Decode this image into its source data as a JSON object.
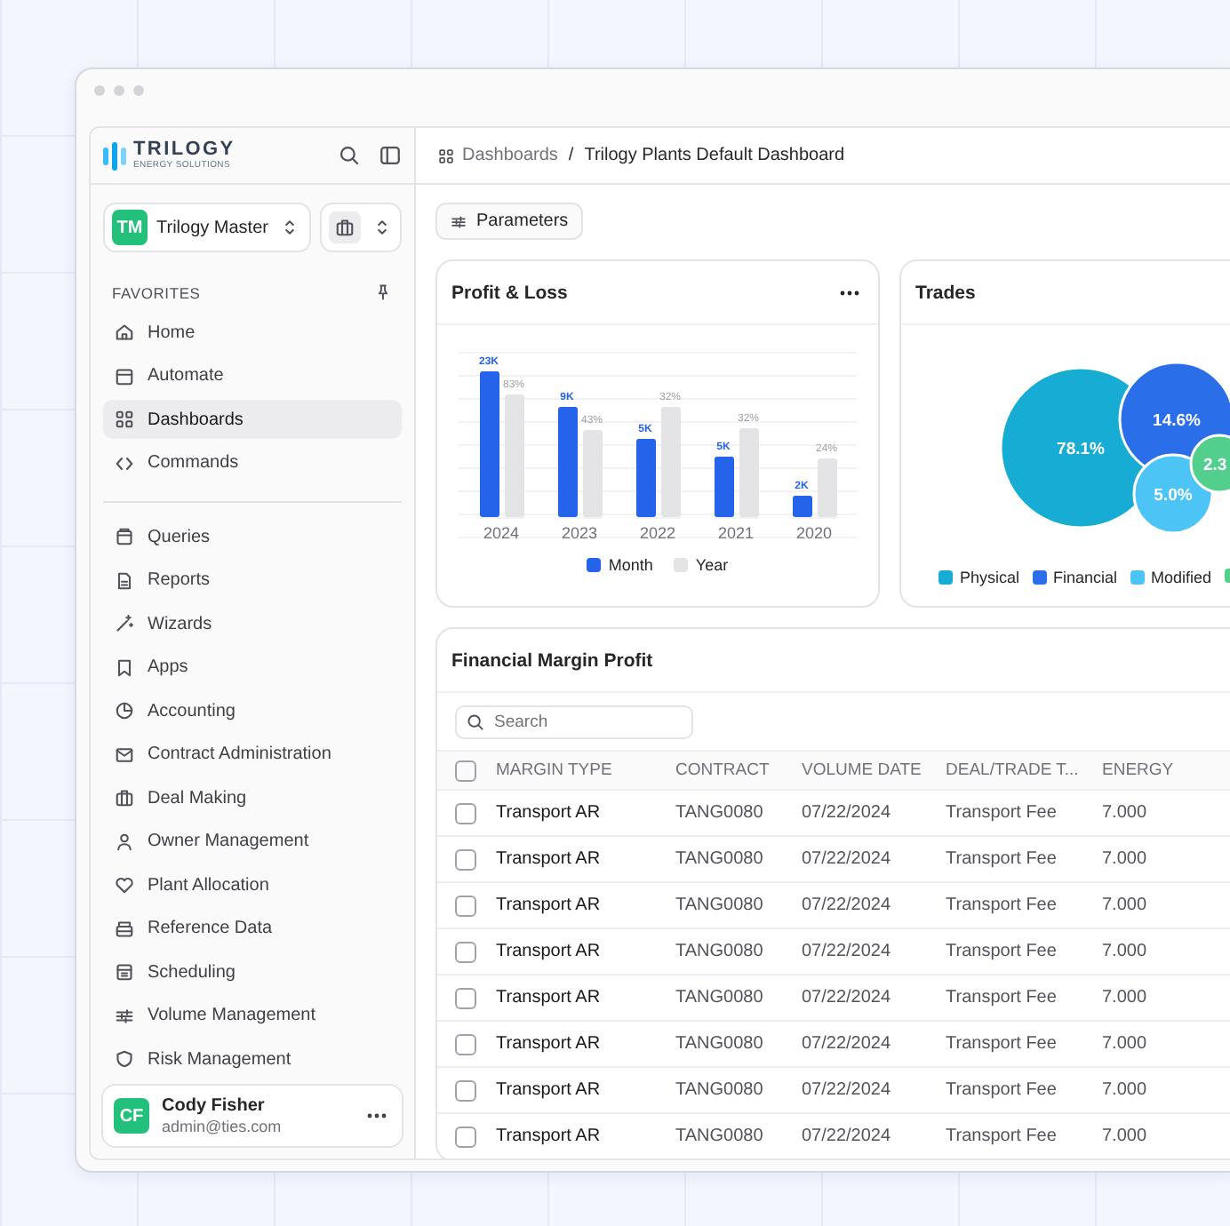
{
  "sidebar": {
    "logo": "TRILOGY",
    "logo_tagline": "ENERGY SOLUTIONS",
    "workspace": {
      "initials": "TM",
      "name": "Trilogy Master"
    },
    "favorites_label": "FAVORITES",
    "favorites": [
      {
        "label": "Home",
        "selected": false
      },
      {
        "label": "Automate",
        "selected": false
      },
      {
        "label": "Dashboards",
        "selected": true
      },
      {
        "label": "Commands",
        "selected": false
      }
    ],
    "items": [
      {
        "label": "Queries",
        "selected": false
      },
      {
        "label": "Reports",
        "selected": false
      },
      {
        "label": "Wizards",
        "selected": false
      },
      {
        "label": "Apps",
        "selected": false
      },
      {
        "label": "Accounting",
        "selected": false
      },
      {
        "label": "Contract Administration",
        "selected": false
      },
      {
        "label": "Deal Making",
        "selected": false
      },
      {
        "label": "Owner Management",
        "selected": false
      },
      {
        "label": "Plant Allocation",
        "selected": false
      },
      {
        "label": "Reference Data",
        "selected": false
      },
      {
        "label": "Scheduling",
        "selected": false
      },
      {
        "label": "Volume Management",
        "selected": false
      },
      {
        "label": "Risk Management",
        "selected": false
      }
    ],
    "user": {
      "initials": "CF",
      "name": "Cody Fisher",
      "email": "admin@ties.com"
    }
  },
  "breadcrumb": {
    "items": [
      "Dashboards",
      "Trilogy Plants Default Dashboard"
    ],
    "separator": "/"
  },
  "parameters_button": "Parameters",
  "profit_loss": {
    "title": "Profit & Loss",
    "legend": [
      {
        "name": "Month",
        "color": "#2563eb"
      },
      {
        "name": "Year",
        "color": "#e4e4e7"
      }
    ],
    "groups": [
      {
        "category": "2024",
        "bars": [
          {
            "label": "23K",
            "level": 0.88
          },
          {
            "label": "83%",
            "level": 0.74
          }
        ]
      },
      {
        "category": "2023",
        "bars": [
          {
            "label": "9K",
            "level": 0.67
          },
          {
            "label": "43%",
            "level": 0.53
          }
        ]
      },
      {
        "category": "2022",
        "bars": [
          {
            "label": "5K",
            "level": 0.47
          },
          {
            "label": "32%",
            "level": 0.67
          }
        ]
      },
      {
        "category": "2021",
        "bars": [
          {
            "label": "5K",
            "level": 0.37
          },
          {
            "label": "32%",
            "level": 0.54
          }
        ]
      },
      {
        "category": "2020",
        "bars": [
          {
            "label": "2K",
            "level": 0.13
          },
          {
            "label": "24%",
            "level": 0.35
          }
        ]
      }
    ]
  },
  "trades": {
    "title": "Trades",
    "bubbles": [
      {
        "name": "Physical",
        "color": "#17acd3",
        "label": "78.1%"
      },
      {
        "name": "Financial",
        "color": "#2b6eea",
        "label": "14.6%"
      },
      {
        "name": "Modified",
        "color": "#4cc4f5",
        "label": "5.0%"
      },
      {
        "color": "#52cf8c",
        "label": "2.3"
      }
    ]
  },
  "margin_table": {
    "title": "Financial Margin Profit",
    "search": {
      "placeholder": "Search"
    },
    "all_checked": false,
    "columns": [
      "MARGIN TYPE",
      "CONTRACT",
      "VOLUME DATE",
      "DEAL/TRADE T...",
      "ENERGY"
    ],
    "rows": [
      {
        "checked": false,
        "cells": [
          "Transport AR",
          "TANG0080",
          "07/22/2024",
          "Transport Fee",
          "7.000"
        ]
      },
      {
        "checked": false,
        "cells": [
          "Transport AR",
          "TANG0080",
          "07/22/2024",
          "Transport Fee",
          "7.000"
        ]
      },
      {
        "checked": false,
        "cells": [
          "Transport AR",
          "TANG0080",
          "07/22/2024",
          "Transport Fee",
          "7.000"
        ]
      },
      {
        "checked": false,
        "cells": [
          "Transport AR",
          "TANG0080",
          "07/22/2024",
          "Transport Fee",
          "7.000"
        ]
      },
      {
        "checked": false,
        "cells": [
          "Transport AR",
          "TANG0080",
          "07/22/2024",
          "Transport Fee",
          "7.000"
        ]
      },
      {
        "checked": false,
        "cells": [
          "Transport AR",
          "TANG0080",
          "07/22/2024",
          "Transport Fee",
          "7.000"
        ]
      },
      {
        "checked": false,
        "cells": [
          "Transport AR",
          "TANG0080",
          "07/22/2024",
          "Transport Fee",
          "7.000"
        ]
      },
      {
        "checked": false,
        "cells": [
          "Transport AR",
          "TANG0080",
          "07/22/2024",
          "Transport Fee",
          "7.000"
        ]
      }
    ]
  }
}
